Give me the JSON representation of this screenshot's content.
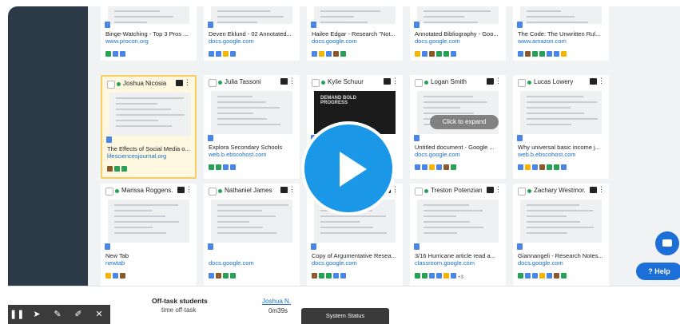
{
  "cards": [
    {
      "name": "",
      "title": "Binge-Watching - Top 3 Pros ...",
      "url": "www.procon.org",
      "top": true
    },
    {
      "name": "",
      "title": "Deven Eklund - 02 Annotated...",
      "url": "docs.google.com",
      "top": true
    },
    {
      "name": "",
      "title": "Hailee Edgar - Research \"Not...",
      "url": "docs.google.com",
      "top": true
    },
    {
      "name": "",
      "title": "Annotated Bibliography - Goo...",
      "url": "docs.google.com",
      "top": true
    },
    {
      "name": "",
      "title": "The Code: The Unwritten Rul...",
      "url": "www.amazon.com",
      "top": true
    },
    {
      "name": "Joshua Nicosia",
      "title": "The Effects of Social Media o...",
      "url": "lifesciencesjournal.org"
    },
    {
      "name": "Julia Tassoni",
      "title": "Explora Secondary Schools",
      "url": "web.b.ebscohost.com"
    },
    {
      "name": "Kylie Schuur",
      "title": "",
      "url": ""
    },
    {
      "name": "Logan Smith",
      "title": "Untitled document - Google ...",
      "url": "docs.google.com"
    },
    {
      "name": "Lucas Lowery",
      "title": "Why universal basic income j...",
      "url": "web.b.ebscohost.com"
    },
    {
      "name": "Marissa Roggens...",
      "title": "New Tab",
      "url": "newtab"
    },
    {
      "name": "Nathaniel James",
      "title": "",
      "url": "docs.google.com"
    },
    {
      "name": "",
      "title": "Copy of Argumentative Resea...",
      "url": "docs.google.com"
    },
    {
      "name": "Treston Potenziani",
      "title": "3/16 Hurricane article read a...",
      "url": "classroom.google.com"
    },
    {
      "name": "Zachary Westmor...",
      "title": "Giannangeli - Research Notes...",
      "url": "docs.google.com"
    }
  ],
  "thumbnail_text": "DEMAND BOLD PROGRESS",
  "expand_label": "Click to expand",
  "extra_tabs_badge": "+3",
  "help_label": "Help",
  "offtask": {
    "title": "Off-task students",
    "subtitle": "time off-task",
    "student": "Joshua N.",
    "time": "0m39s"
  },
  "system_status": "System Status",
  "colors": {
    "sidebar": "#2b3a46",
    "accent": "#1a97e6",
    "link": "#1a6fc4",
    "highlight": "#f3cf63"
  }
}
